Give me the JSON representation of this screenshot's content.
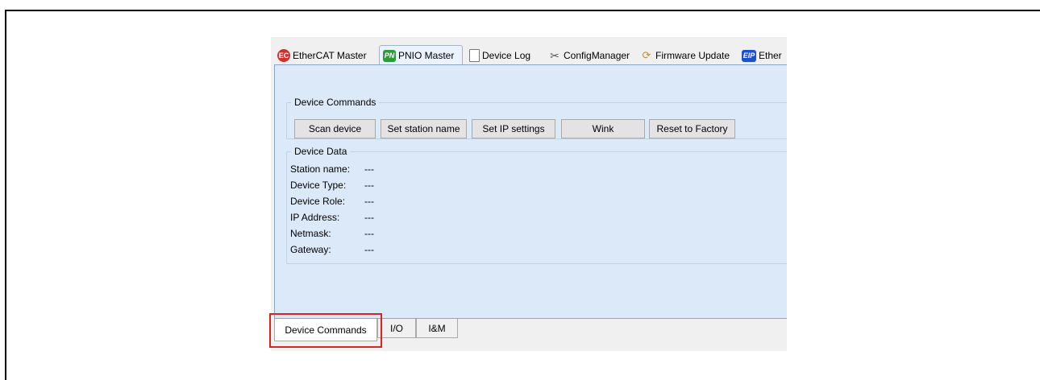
{
  "top_tabs": [
    {
      "label": "EtherCAT Master",
      "icon": "ethercat-icon",
      "icon_text": "EC"
    },
    {
      "label": "PNIO Master",
      "icon": "pn-icon",
      "icon_text": "PN"
    },
    {
      "label": "Device Log",
      "icon": "clipboard-icon"
    },
    {
      "label": "ConfigManager",
      "icon": "tools-icon"
    },
    {
      "label": "Firmware Update",
      "icon": "firmware-update-icon"
    },
    {
      "label": "Ether",
      "icon": "eip-icon",
      "icon_text": "EIP"
    }
  ],
  "device_commands": {
    "title": "Device Commands",
    "buttons": [
      "Scan device",
      "Set station name",
      "Set IP settings",
      "Wink",
      "Reset to Factory"
    ]
  },
  "device_data": {
    "title": "Device Data",
    "rows": [
      {
        "label": "Station name:",
        "value": "---"
      },
      {
        "label": "Device Type:",
        "value": "---"
      },
      {
        "label": "Device Role:",
        "value": "---"
      },
      {
        "label": "IP Address:",
        "value": "---"
      },
      {
        "label": "Netmask:",
        "value": "---"
      },
      {
        "label": "Gateway:",
        "value": "---"
      }
    ]
  },
  "bottom_tabs": [
    "Device Commands",
    "I/O",
    "I&M"
  ],
  "colors": {
    "highlight": "#e0221e",
    "panel_bg": "#dce9f9"
  }
}
